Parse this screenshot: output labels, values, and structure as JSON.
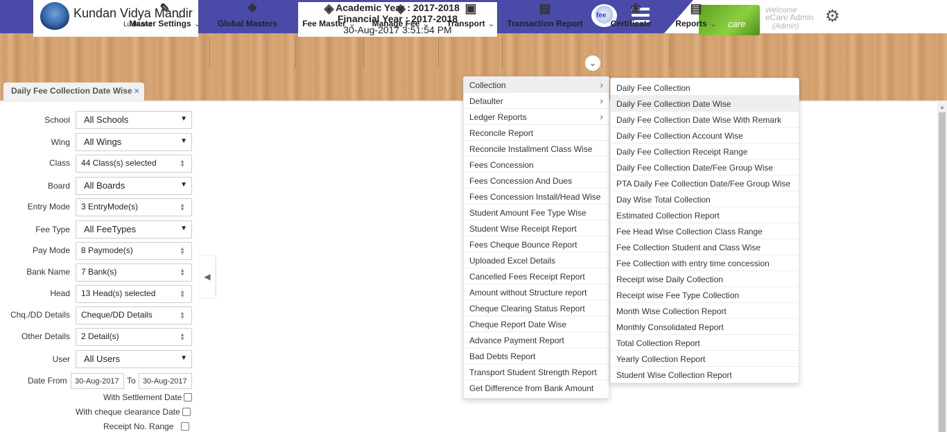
{
  "header": {
    "school_name": "Kundan Vidya Mandir",
    "school_city": "Ludhiana",
    "academic_year": "Academic Year : 2017-2018",
    "financial_year": "Financial Year : 2017-2018",
    "datetime": "30-Aug-2017 3:51:54 PM",
    "fm_logo_text": "fee",
    "ecare_logo_text": "care",
    "welcome": "Welcome",
    "user_name": "eCare Admin",
    "user_role": "(Admin)"
  },
  "nav": {
    "items": [
      {
        "label": "Master Settings",
        "icon": "users-edit-icon"
      },
      {
        "label": "Global Masters",
        "icon": "handshake-icon"
      },
      {
        "label": "Fee Master",
        "icon": "money-icon"
      },
      {
        "label": "Manage Fee",
        "icon": "money-icon"
      },
      {
        "label": "Transport",
        "icon": "bus-icon"
      },
      {
        "label": "Transaction Report",
        "icon": "report-icon"
      },
      {
        "label": "Certificate",
        "icon": "medal-icon"
      },
      {
        "label": "Reports",
        "icon": "report-icon"
      }
    ]
  },
  "tab": {
    "label": "Daily Fee Collection Date Wise",
    "close": "×"
  },
  "form": {
    "school": {
      "label": "School",
      "value": "All Schools"
    },
    "wing": {
      "label": "Wing",
      "value": "All Wings"
    },
    "class": {
      "label": "Class",
      "value": "44 Class(s) selected"
    },
    "board": {
      "label": "Board",
      "value": "All Boards"
    },
    "entry_mode": {
      "label": "Entry Mode",
      "value": "3 EntryMode(s)"
    },
    "fee_type": {
      "label": "Fee Type",
      "value": "All FeeTypes"
    },
    "pay_mode": {
      "label": "Pay Mode",
      "value": "8 Paymode(s)"
    },
    "bank_name": {
      "label": "Bank Name",
      "value": "7 Bank(s)"
    },
    "head": {
      "label": "Head",
      "value": "13 Head(s) selected"
    },
    "chq_dd": {
      "label": "Chq./DD Details",
      "value": "Cheque/DD Details"
    },
    "other": {
      "label": "Other Details",
      "value": "2 Detail(s)"
    },
    "user": {
      "label": "User",
      "value": "All Users"
    },
    "date_from_label": "Date From",
    "date_from": "30-Aug-2017",
    "to_label": "To",
    "date_to": "30-Aug-2017",
    "with_settlement": "With Settlement Date",
    "with_cheque": "With cheque clearance Date",
    "receipt_range": "Receipt No. Range"
  },
  "menu_level1": [
    "Collection",
    "Defaulter",
    "Ledger Reports",
    "Reconcile Report",
    "Reconcile Installment Class Wise",
    "Fees Concession",
    "Fees Concession And Dues",
    "Fees Concession Install/Head Wise",
    "Student Amount Fee Type Wise",
    "Student Wise Receipt Report",
    "Fees Cheque Bounce Report",
    "Uploaded Excel Details",
    "Cancelled Fees Receipt Report",
    "Amount without Structure report",
    "Cheque Clearing Status Report",
    "Cheque Report Date Wise",
    "Advance Payment Report",
    "Bad Debts Report",
    "Transport Student Strength Report",
    "Get Difference from Bank Amount"
  ],
  "menu_level2": [
    "Daily Fee Collection",
    "Daily Fee Collection Date Wise",
    "Daily Fee Collection Date Wise With Remark",
    "Daily Fee Collection Account Wise",
    "Daily Fee Collection Receipt Range",
    "Daily Fee Collection Date/Fee Group Wise",
    "PTA Daily Fee Collection Date/Fee Group Wise",
    "Day Wise Total Collection",
    "Estimated Collection Report",
    "Fee Head Wise Collection Class Range",
    "Fee Collection Student and Class Wise",
    "Fee Collection with entry time concession",
    "Receipt wise Daily Collection",
    "Receipt wise Fee Type Collection",
    "Month Wise Collection Report",
    "Monthly Consolidated Report",
    "Total Collection Report",
    "Yearly Collection Report",
    "Student Wise Collection Report"
  ]
}
